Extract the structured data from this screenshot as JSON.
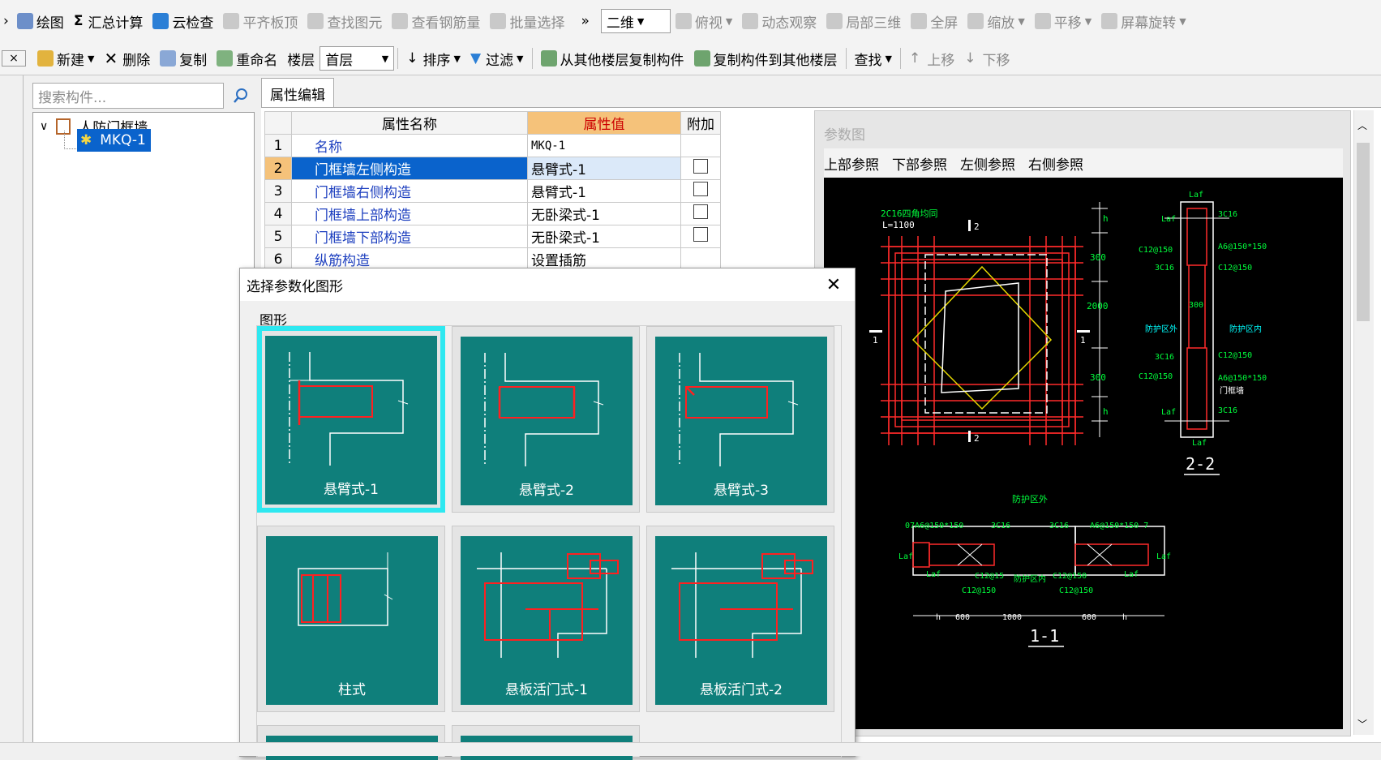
{
  "toolbar1": {
    "items": [
      {
        "label": "绘图",
        "icon": "draw-icon",
        "enabled": true
      },
      {
        "label": "汇总计算",
        "icon": "sigma-icon",
        "enabled": true
      },
      {
        "label": "云检查",
        "icon": "cloud-check-icon",
        "enabled": true
      },
      {
        "label": "平齐板顶",
        "icon": "align-slab-icon",
        "enabled": false
      },
      {
        "label": "查找图元",
        "icon": "find-element-icon",
        "enabled": false
      },
      {
        "label": "查看钢筋量",
        "icon": "rebar-quantity-icon",
        "enabled": false
      },
      {
        "label": "批量选择",
        "icon": "batch-select-icon",
        "enabled": false
      }
    ],
    "overflow": "»",
    "view_mode": "二维",
    "view_items": [
      {
        "label": "俯视",
        "icon": "top-view-icon",
        "dropdown": true
      },
      {
        "label": "动态观察",
        "icon": "orbit-icon",
        "dropdown": false
      },
      {
        "label": "局部三维",
        "icon": "local-3d-icon",
        "dropdown": false
      },
      {
        "label": "全屏",
        "icon": "fullscreen-icon",
        "dropdown": false
      },
      {
        "label": "缩放",
        "icon": "zoom-icon",
        "dropdown": true
      },
      {
        "label": "平移",
        "icon": "pan-icon",
        "dropdown": true
      },
      {
        "label": "屏幕旋转",
        "icon": "rotate-icon",
        "dropdown": true
      }
    ]
  },
  "toolbar2": {
    "new_label": "新建",
    "delete_label": "删除",
    "copy_label": "复制",
    "rename_label": "重命名",
    "floor_label": "楼层",
    "floor_value": "首层",
    "sort_label": "排序",
    "filter_label": "过滤",
    "copy_from_label": "从其他楼层复制构件",
    "copy_to_label": "复制构件到其他楼层",
    "find_label": "查找",
    "move_up_label": "上移",
    "move_down_label": "下移",
    "close_glyph": "×"
  },
  "left_panel": {
    "search_placeholder": "搜索构件...",
    "tree": {
      "root": "人防门框墙",
      "child": "MKQ-1"
    }
  },
  "property_panel": {
    "tab": "属性编辑",
    "headers": [
      "属性名称",
      "属性值",
      "附加"
    ],
    "rows": [
      {
        "no": "1",
        "name": "名称",
        "value": "MKQ-1",
        "has_check": false
      },
      {
        "no": "2",
        "name": "门框墙左侧构造",
        "value": "悬臂式-1",
        "has_check": true
      },
      {
        "no": "3",
        "name": "门框墙右侧构造",
        "value": "悬臂式-1",
        "has_check": true
      },
      {
        "no": "4",
        "name": "门框墙上部构造",
        "value": "无卧梁式-1",
        "has_check": true
      },
      {
        "no": "5",
        "name": "门框墙下部构造",
        "value": "无卧梁式-1",
        "has_check": true
      },
      {
        "no": "6",
        "name": "纵筋构造",
        "value": "设置插筋",
        "has_check": false
      }
    ]
  },
  "drawing": {
    "title": "参数图",
    "refs": [
      "上部参照",
      "下部参照",
      "左侧参照",
      "右侧参照"
    ],
    "labels": {
      "rebar_top": "2C16四角均同",
      "l_len": "L=1100",
      "sec2": "2",
      "sec1": "1",
      "h": "h",
      "d300a": "300",
      "d2000": "2000",
      "d300b": "300",
      "laf": "Laf",
      "c3c16": "3C16",
      "c12": "C12@150",
      "a6": "A6@150*150",
      "d300c": "300",
      "outside": "防护区外",
      "inside": "防护区内",
      "door_frame": "门框墙",
      "title22": "2-2",
      "title11": "1-1",
      "b_outside": "防护区外",
      "b_inside": "防护区内",
      "b_a6left": "07A6@150*150",
      "b_a6right": "A6@150*150 7",
      "b_c12a": "C12@15",
      "b_c12b": "C12@150",
      "b_c12c": "C12@150",
      "b_c12d": "C12@150",
      "d600a": "600",
      "d1000": "1000",
      "d600b": "600"
    }
  },
  "dialog": {
    "title": "选择参数化图形",
    "group": "图形",
    "tiles": [
      {
        "label": "悬臂式-1",
        "selected": true,
        "kind": "cantilever1"
      },
      {
        "label": "悬臂式-2",
        "selected": false,
        "kind": "cantilever2"
      },
      {
        "label": "悬臂式-3",
        "selected": false,
        "kind": "cantilever3"
      },
      {
        "label": "柱式",
        "selected": false,
        "kind": "column"
      },
      {
        "label": "悬板活门式-1",
        "selected": false,
        "kind": "flap1"
      },
      {
        "label": "悬板活门式-2",
        "selected": false,
        "kind": "flap2"
      }
    ]
  },
  "colors": {
    "tile_bg": "#0f7f7b",
    "tile_selected": "#2ee8f0",
    "rebar": "#ff2020",
    "sel_row": "#0a63cc",
    "prop_value_header": "#f5c27a"
  }
}
